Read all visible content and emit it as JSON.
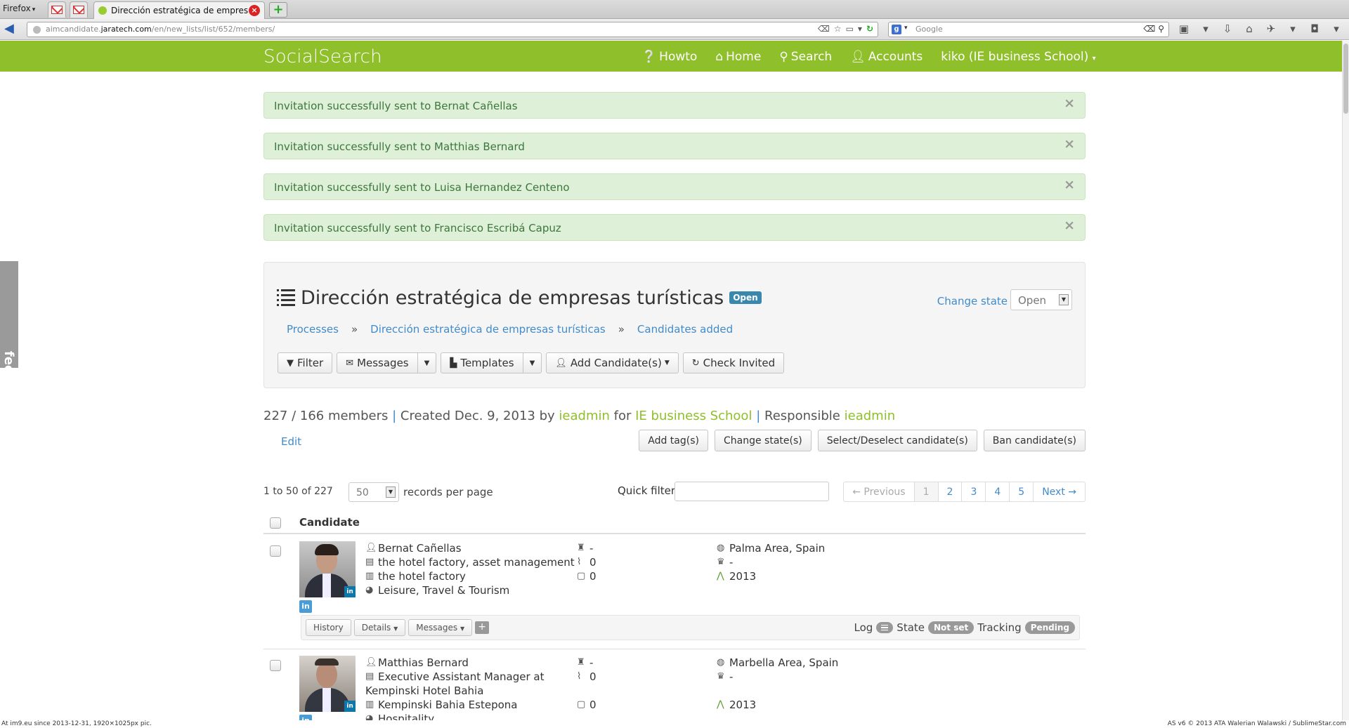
{
  "browser": {
    "menu_label": "Firefox",
    "active_tab_title": "Dirección estratégica de empres...",
    "url_prefix": "aimcandidate.",
    "url_domain": "jaratech.com",
    "url_path": "/en/new_lists/list/652/members/",
    "search_engine": "Google"
  },
  "header": {
    "brand": "SocialSearch",
    "nav": [
      {
        "label": "Howto",
        "icon": "question-circle-icon"
      },
      {
        "label": "Home",
        "icon": "home-icon"
      },
      {
        "label": "Search",
        "icon": "search-icon"
      },
      {
        "label": "Accounts",
        "icon": "user-icon"
      },
      {
        "label": "kiko (IE business School)",
        "icon": "caret-down-icon"
      }
    ]
  },
  "alerts": [
    "Invitation successfully sent to Bernat Cañellas",
    "Invitation successfully sent to Matthias Bernard",
    "Invitation successfully sent to Luisa Hernandez Centeno",
    "Invitation successfully sent to Francisco Escribá Capuz"
  ],
  "feedback_label": "feedback",
  "list": {
    "title": "Dirección estratégica de empresas turísticas",
    "status_label": "Open",
    "change_state_label": "Change state",
    "state_value": "Open",
    "breadcrumbs": [
      "Processes",
      "Dirección estratégica de empresas turísticas",
      "Candidates added"
    ],
    "toolbar": {
      "filter": "Filter",
      "messages": "Messages",
      "templates": "Templates",
      "add_candidates": "Add Candidate(s)",
      "check_invited": "Check Invited"
    }
  },
  "summary": {
    "members": "227 / 166 members",
    "created": "Created Dec. 9, 2013 by",
    "created_by": "ieadmin",
    "for": "for",
    "organization": "IE business School",
    "responsible_label": "Responsible",
    "responsible": "ieadmin",
    "edit": "Edit"
  },
  "actions": [
    "Add tag(s)",
    "Change state(s)",
    "Select/Deselect candidate(s)",
    "Ban candidate(s)"
  ],
  "paging": {
    "records": "1 to 50 of 227",
    "per_page": "50",
    "per_page_label": "records per page",
    "quick_filter_label": "Quick filter:",
    "quick_filter_value": "",
    "pages": [
      "← Previous",
      "1",
      "2",
      "3",
      "4",
      "5",
      "Next →"
    ]
  },
  "table": {
    "column_header": "Candidate",
    "rows": [
      {
        "name": "Bernat Cañellas",
        "position": "the hotel factory, asset management",
        "company": "the hotel factory",
        "industry": "Leisure, Travel & Tourism",
        "award": "-",
        "score1": "0",
        "score2": "0",
        "location": "Palma Area, Spain",
        "education": "-",
        "year": "2013",
        "history": "History",
        "details": "Details",
        "messages": "Messages",
        "log": "Log",
        "state_label": "State",
        "state": "Not set",
        "tracking_label": "Tracking",
        "tracking": "Pending"
      },
      {
        "name": "Matthias Bernard",
        "position": "Executive Assistant Manager at",
        "position2": "Kempinski Hotel Bahia",
        "company": "Kempinski Bahia Estepona",
        "industry": "Hospitality",
        "award": "-",
        "score1": "0",
        "score2": "0",
        "location": "Marbella Area, Spain",
        "education": "-",
        "year": "2013"
      }
    ]
  },
  "statusbar": {
    "left": "At im9.eu  since 2013-12-31, 1920×1025px pic.",
    "right": "AS v6 © 2013 ATA Walerian Walawski / SublimeStar.com"
  }
}
